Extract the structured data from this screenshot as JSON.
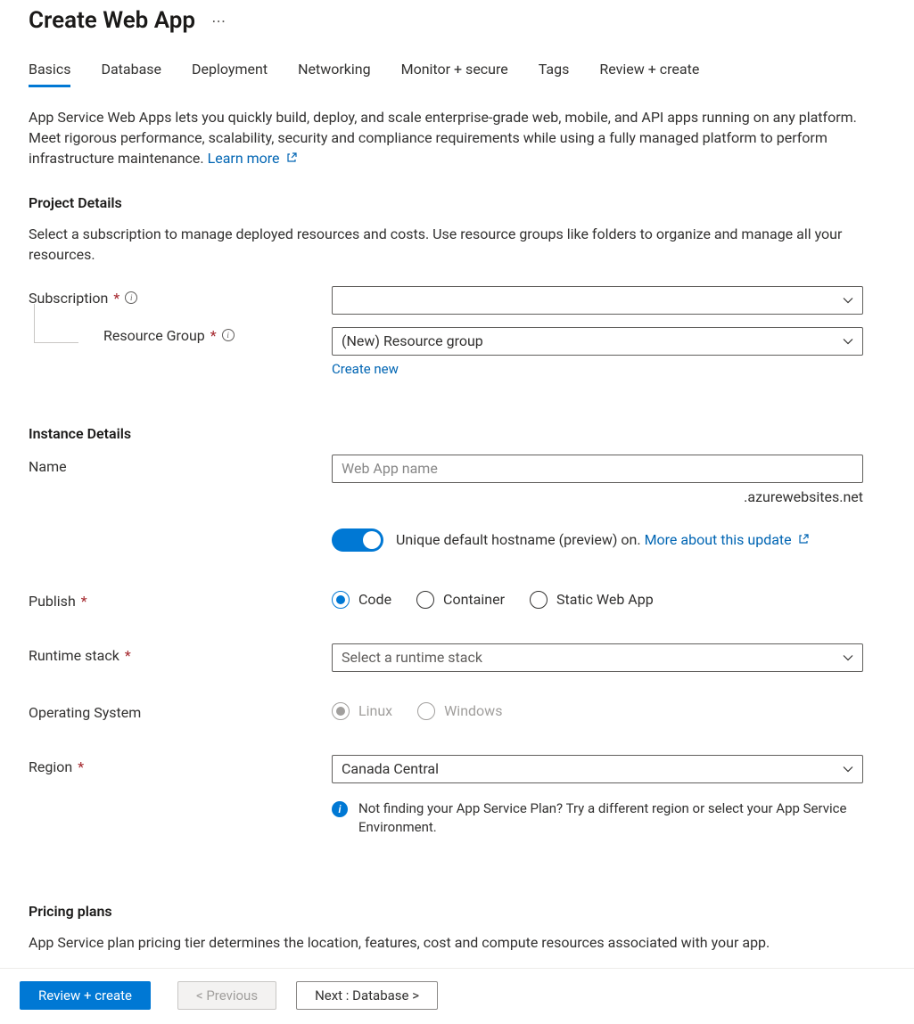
{
  "header": {
    "title": "Create Web App"
  },
  "tabs": [
    {
      "label": "Basics",
      "active": true
    },
    {
      "label": "Database"
    },
    {
      "label": "Deployment"
    },
    {
      "label": "Networking"
    },
    {
      "label": "Monitor + secure"
    },
    {
      "label": "Tags"
    },
    {
      "label": "Review + create"
    }
  ],
  "intro": {
    "text": "App Service Web Apps lets you quickly build, deploy, and scale enterprise-grade web, mobile, and API apps running on any platform. Meet rigorous performance, scalability, security and compliance requirements while using a fully managed platform to perform infrastructure maintenance.  ",
    "learn_more": "Learn more"
  },
  "project_details": {
    "heading": "Project Details",
    "desc": "Select a subscription to manage deployed resources and costs. Use resource groups like folders to organize and manage all your resources.",
    "subscription_label": "Subscription",
    "subscription_value": "",
    "resource_group_label": "Resource Group",
    "resource_group_value": "(New) Resource group",
    "create_new": "Create new"
  },
  "instance_details": {
    "heading": "Instance Details",
    "name_label": "Name",
    "name_placeholder": "Web App name",
    "domain_suffix": ".azurewebsites.net",
    "toggle_text": "Unique default hostname (preview) on.",
    "toggle_link": "More about this update",
    "publish_label": "Publish",
    "publish_options": {
      "code": "Code",
      "container": "Container",
      "static": "Static Web App"
    },
    "runtime_label": "Runtime stack",
    "runtime_placeholder": "Select a runtime stack",
    "os_label": "Operating System",
    "os_options": {
      "linux": "Linux",
      "windows": "Windows"
    },
    "region_label": "Region",
    "region_value": "Canada Central",
    "region_info": "Not finding your App Service Plan? Try a different region or select your App Service Environment."
  },
  "pricing": {
    "heading": "Pricing plans",
    "desc": "App Service plan pricing tier determines the location, features, cost and compute resources associated with your app."
  },
  "footer": {
    "review": "Review + create",
    "previous": "< Previous",
    "next": "Next : Database >"
  }
}
